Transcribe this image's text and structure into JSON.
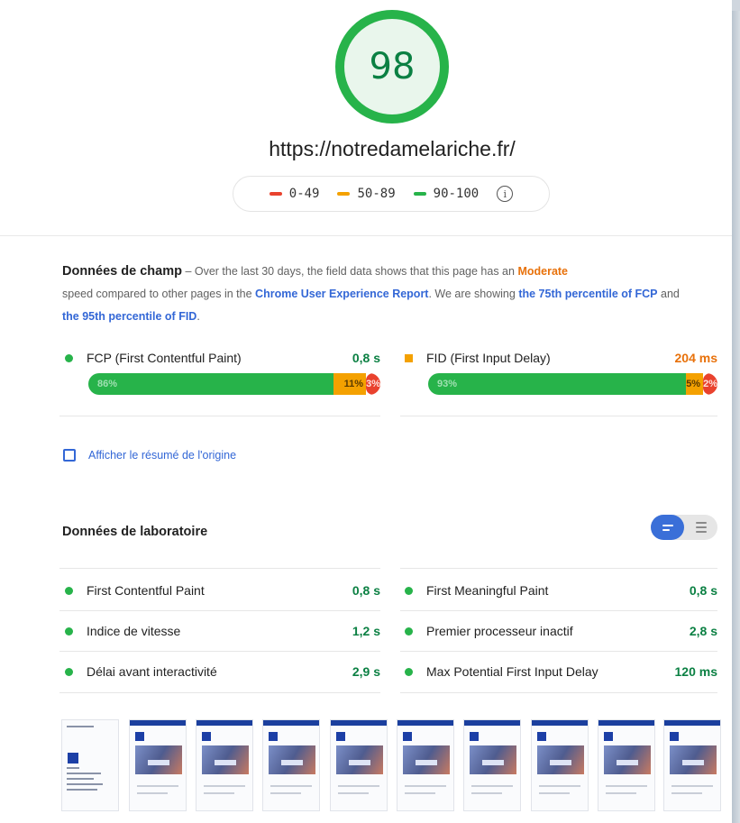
{
  "score": {
    "value": "98",
    "url": "https://notredamelariche.fr/"
  },
  "legend": [
    {
      "label": "0-49",
      "color": "#e9422e"
    },
    {
      "label": "50-89",
      "color": "#f4a100"
    },
    {
      "label": "90-100",
      "color": "#27b34a"
    }
  ],
  "field": {
    "title": "Données de champ",
    "dash": "–",
    "text1": "Over the last 30 days, the field data shows that this page has an",
    "moderate": "Moderate",
    "text2": "speed compared to other pages in the",
    "crux": "Chrome User Experience Report",
    "text3": ". We are showing",
    "p75": "the 75th percentile of FCP",
    "and": "and",
    "p95": "the 95th percentile of FID",
    "dot": ".",
    "fcp": {
      "label": "FCP (First Contentful Paint)",
      "value": "0,8 s",
      "value_color": "#0b8043",
      "good": "86%",
      "avg": "11%",
      "bad": "3%",
      "good_pct": 86,
      "avg_pct": 11,
      "bad_pct": 3
    },
    "fid": {
      "label": "FID (First Input Delay)",
      "value": "204 ms",
      "value_color": "#e8710a",
      "good": "93%",
      "avg": "5%",
      "bad": "2%",
      "good_pct": 93,
      "avg_pct": 5,
      "bad_pct": 2
    }
  },
  "origin_summary": "Afficher le résumé de l'origine",
  "lab": {
    "title": "Données de laboratoire",
    "metrics": [
      {
        "label": "First Contentful Paint",
        "value": "0,8 s"
      },
      {
        "label": "First Meaningful Paint",
        "value": "0,8 s"
      },
      {
        "label": "Indice de vitesse",
        "value": "1,2 s"
      },
      {
        "label": "Premier processeur inactif",
        "value": "2,8 s"
      },
      {
        "label": "Délai avant interactivité",
        "value": "2,9 s"
      },
      {
        "label": "Max Potential First Input Delay",
        "value": "120 ms"
      }
    ]
  },
  "colors": {
    "good": "#27b34a",
    "average": "#f4a100",
    "poor": "#e9422e",
    "link": "#3367d6"
  }
}
